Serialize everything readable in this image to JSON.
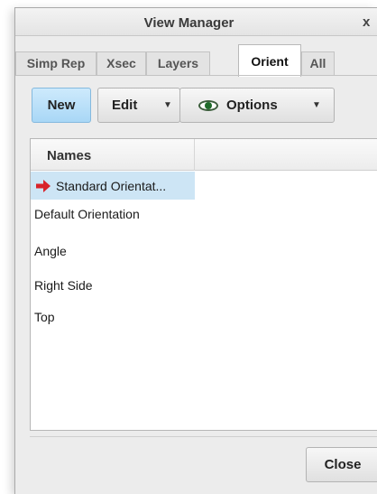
{
  "window": {
    "title": "View Manager",
    "close_glyph": "x"
  },
  "tabs": [
    {
      "label": "Simp Rep",
      "active": false
    },
    {
      "label": "Xsec",
      "active": false
    },
    {
      "label": "Layers",
      "active": false
    },
    {
      "label": "Orient",
      "active": true
    },
    {
      "label": "All",
      "active": false
    }
  ],
  "toolbar": {
    "new_label": "New",
    "edit_label": "Edit",
    "options_label": "Options",
    "options_icon": "eye-icon",
    "dropdown_icon": "caret-down-icon"
  },
  "list": {
    "columns": [
      "Names"
    ],
    "rows": [
      {
        "label": "Standard Orientat...",
        "selected": true,
        "icon": "red-arrow-icon"
      },
      {
        "label": "Default Orientation",
        "selected": false
      },
      {
        "label": "Angle",
        "selected": false
      },
      {
        "label": "Right Side",
        "selected": false
      },
      {
        "label": "Top",
        "selected": false
      }
    ]
  },
  "footer": {
    "close_label": "Close"
  },
  "colors": {
    "accent_new_button": "#b9def8",
    "selected_row": "#cde5f5",
    "arrow": "#d8232a",
    "eye": "#1f6b2a"
  }
}
